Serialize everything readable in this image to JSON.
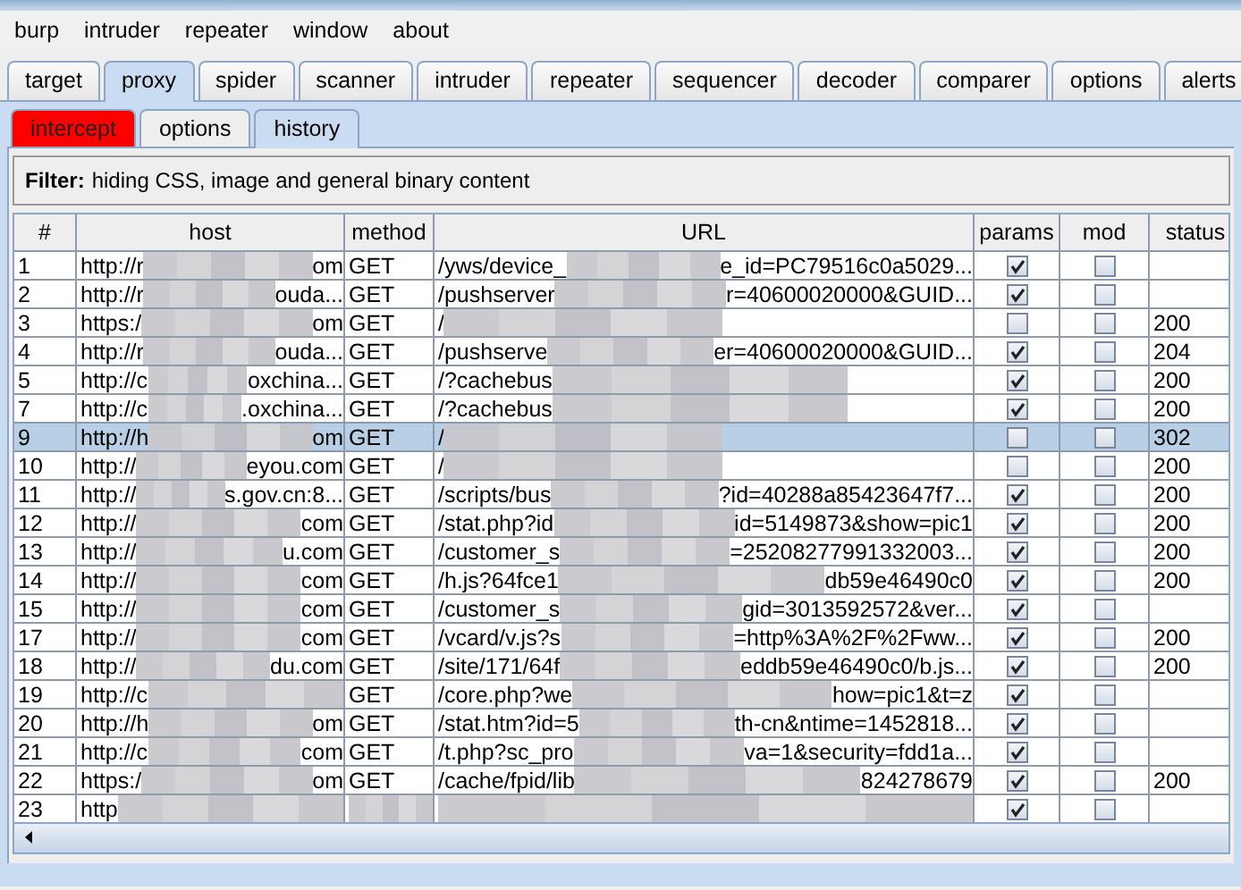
{
  "menu": [
    "burp",
    "intruder",
    "repeater",
    "window",
    "about"
  ],
  "tabs": [
    {
      "label": "target",
      "selected": false
    },
    {
      "label": "proxy",
      "selected": true
    },
    {
      "label": "spider",
      "selected": false
    },
    {
      "label": "scanner",
      "selected": false
    },
    {
      "label": "intruder",
      "selected": false
    },
    {
      "label": "repeater",
      "selected": false
    },
    {
      "label": "sequencer",
      "selected": false
    },
    {
      "label": "decoder",
      "selected": false
    },
    {
      "label": "comparer",
      "selected": false
    },
    {
      "label": "options",
      "selected": false
    },
    {
      "label": "alerts",
      "selected": false
    }
  ],
  "subtabs": [
    {
      "label": "intercept",
      "selected": false,
      "highlighted": true
    },
    {
      "label": "options",
      "selected": false,
      "highlighted": false
    },
    {
      "label": "history",
      "selected": true,
      "highlighted": false
    }
  ],
  "filter": {
    "label": "Filter:",
    "text": "hiding CSS, image and general binary content"
  },
  "table": {
    "columns": [
      "#",
      "host",
      "method",
      "URL",
      "params",
      "mod",
      "status"
    ],
    "rows": [
      {
        "num": "1",
        "host_start": "http://r",
        "host_end": "om",
        "method": "GET",
        "url_start": "/yws/device_",
        "url_end": "e_id=PC79516c0a5029...",
        "params": true,
        "mod": false,
        "status": "",
        "selected": false
      },
      {
        "num": "2",
        "host_start": "http://r",
        "host_end": "ouda...",
        "method": "GET",
        "url_start": "/pushserver",
        "url_end": "r=40600020000&GUID...",
        "params": true,
        "mod": false,
        "status": "",
        "selected": false
      },
      {
        "num": "3",
        "host_start": "https:/",
        "host_end": "om",
        "method": "GET",
        "url_start": "/",
        "url_end": "",
        "params": false,
        "mod": false,
        "status": "200",
        "selected": false
      },
      {
        "num": "4",
        "host_start": "http://r",
        "host_end": "ouda...",
        "method": "GET",
        "url_start": "/pushserve",
        "url_end": "er=40600020000&GUID...",
        "params": true,
        "mod": false,
        "status": "204",
        "selected": false
      },
      {
        "num": "5",
        "host_start": "http://c",
        "host_end": "oxchina...",
        "method": "GET",
        "url_start": "/?cachebus",
        "url_end": "",
        "params": true,
        "mod": false,
        "status": "200",
        "selected": false
      },
      {
        "num": "7",
        "host_start": "http://c",
        "host_end": ".oxchina...",
        "method": "GET",
        "url_start": "/?cachebus",
        "url_end": "",
        "params": true,
        "mod": false,
        "status": "200",
        "selected": false
      },
      {
        "num": "9",
        "host_start": "http://h",
        "host_end": "om",
        "method": "GET",
        "url_start": "/",
        "url_end": "",
        "params": false,
        "mod": false,
        "status": "302",
        "selected": true
      },
      {
        "num": "10",
        "host_start": "http://",
        "host_end": "eyou.com",
        "method": "GET",
        "url_start": "/",
        "url_end": "",
        "params": false,
        "mod": false,
        "status": "200",
        "selected": false
      },
      {
        "num": "11",
        "host_start": "http://",
        "host_end": "s.gov.cn:8...",
        "method": "GET",
        "url_start": "/scripts/bus",
        "url_end": "?id=40288a85423647f7...",
        "params": true,
        "mod": false,
        "status": "200",
        "selected": false
      },
      {
        "num": "12",
        "host_start": "http://",
        "host_end": "com",
        "method": "GET",
        "url_start": "/stat.php?id",
        "url_end": "id=5149873&show=pic1",
        "params": true,
        "mod": false,
        "status": "200",
        "selected": false
      },
      {
        "num": "13",
        "host_start": "http://",
        "host_end": "u.com",
        "method": "GET",
        "url_start": "/customer_s",
        "url_end": "=25208277991332003...",
        "params": true,
        "mod": false,
        "status": "200",
        "selected": false
      },
      {
        "num": "14",
        "host_start": "http://",
        "host_end": "com",
        "method": "GET",
        "url_start": "/h.js?64fce1",
        "url_end": "db59e46490c0",
        "params": true,
        "mod": false,
        "status": "200",
        "selected": false
      },
      {
        "num": "15",
        "host_start": "http://",
        "host_end": "com",
        "method": "GET",
        "url_start": "/customer_s",
        "url_end": "gid=3013592572&ver...",
        "params": true,
        "mod": false,
        "status": "",
        "selected": false
      },
      {
        "num": "17",
        "host_start": "http://",
        "host_end": "com",
        "method": "GET",
        "url_start": "/vcard/v.js?s",
        "url_end": "=http%3A%2F%2Fww...",
        "params": true,
        "mod": false,
        "status": "200",
        "selected": false
      },
      {
        "num": "18",
        "host_start": "http://",
        "host_end": "du.com",
        "method": "GET",
        "url_start": "/site/171/64f",
        "url_end": "eddb59e46490c0/b.js...",
        "params": true,
        "mod": false,
        "status": "200",
        "selected": false
      },
      {
        "num": "19",
        "host_start": "http://c",
        "host_end": "",
        "method": "GET",
        "url_start": "/core.php?we",
        "url_end": "how=pic1&t=z",
        "params": true,
        "mod": false,
        "status": "",
        "selected": false
      },
      {
        "num": "20",
        "host_start": "http://h",
        "host_end": "om",
        "method": "GET",
        "url_start": "/stat.htm?id=5",
        "url_end": "th-cn&ntime=1452818...",
        "params": true,
        "mod": false,
        "status": "",
        "selected": false
      },
      {
        "num": "21",
        "host_start": "http://c",
        "host_end": "com",
        "method": "GET",
        "url_start": "/t.php?sc_pro",
        "url_end": "va=1&security=fdd1a...",
        "params": true,
        "mod": false,
        "status": "",
        "selected": false
      },
      {
        "num": "22",
        "host_start": "https:/",
        "host_end": "om",
        "method": "GET",
        "url_start": "/cache/fpid/lib",
        "url_end": "824278679",
        "params": true,
        "mod": false,
        "status": "200",
        "selected": false
      },
      {
        "num": "23",
        "host_start": "http",
        "host_end": "",
        "method": "",
        "url_start": "",
        "url_end": "",
        "params": true,
        "mod": false,
        "status": "",
        "selected": false
      }
    ]
  }
}
